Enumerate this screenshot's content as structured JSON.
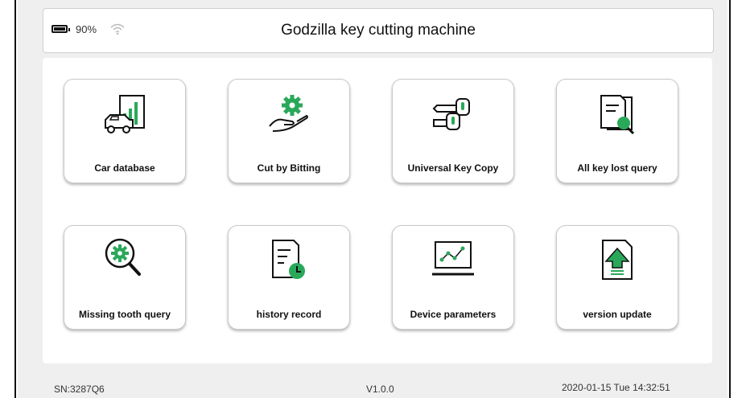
{
  "header": {
    "battery_percent": "90%",
    "title": "Godzilla key cutting machine"
  },
  "tiles": [
    {
      "label": "Car database",
      "icon": "car-database-icon"
    },
    {
      "label": "Cut by Bitting",
      "icon": "gear-hand-icon"
    },
    {
      "label": "Universal Key Copy",
      "icon": "key-copy-icon"
    },
    {
      "label": "All key lost query",
      "icon": "document-search-icon"
    },
    {
      "label": "Missing tooth query",
      "icon": "gear-search-icon"
    },
    {
      "label": "history record",
      "icon": "history-document-icon"
    },
    {
      "label": "Device parameters",
      "icon": "monitor-chart-icon"
    },
    {
      "label": "version update",
      "icon": "upload-arrow-icon"
    }
  ],
  "footer": {
    "serial": "SN:3287Q6",
    "version": "V1.0.0",
    "datetime": "2020-01-15 Tue 14:32:51"
  },
  "colors": {
    "accent": "#2aa85a",
    "icon_stroke": "#111111",
    "screen_bg": "#efefef"
  }
}
